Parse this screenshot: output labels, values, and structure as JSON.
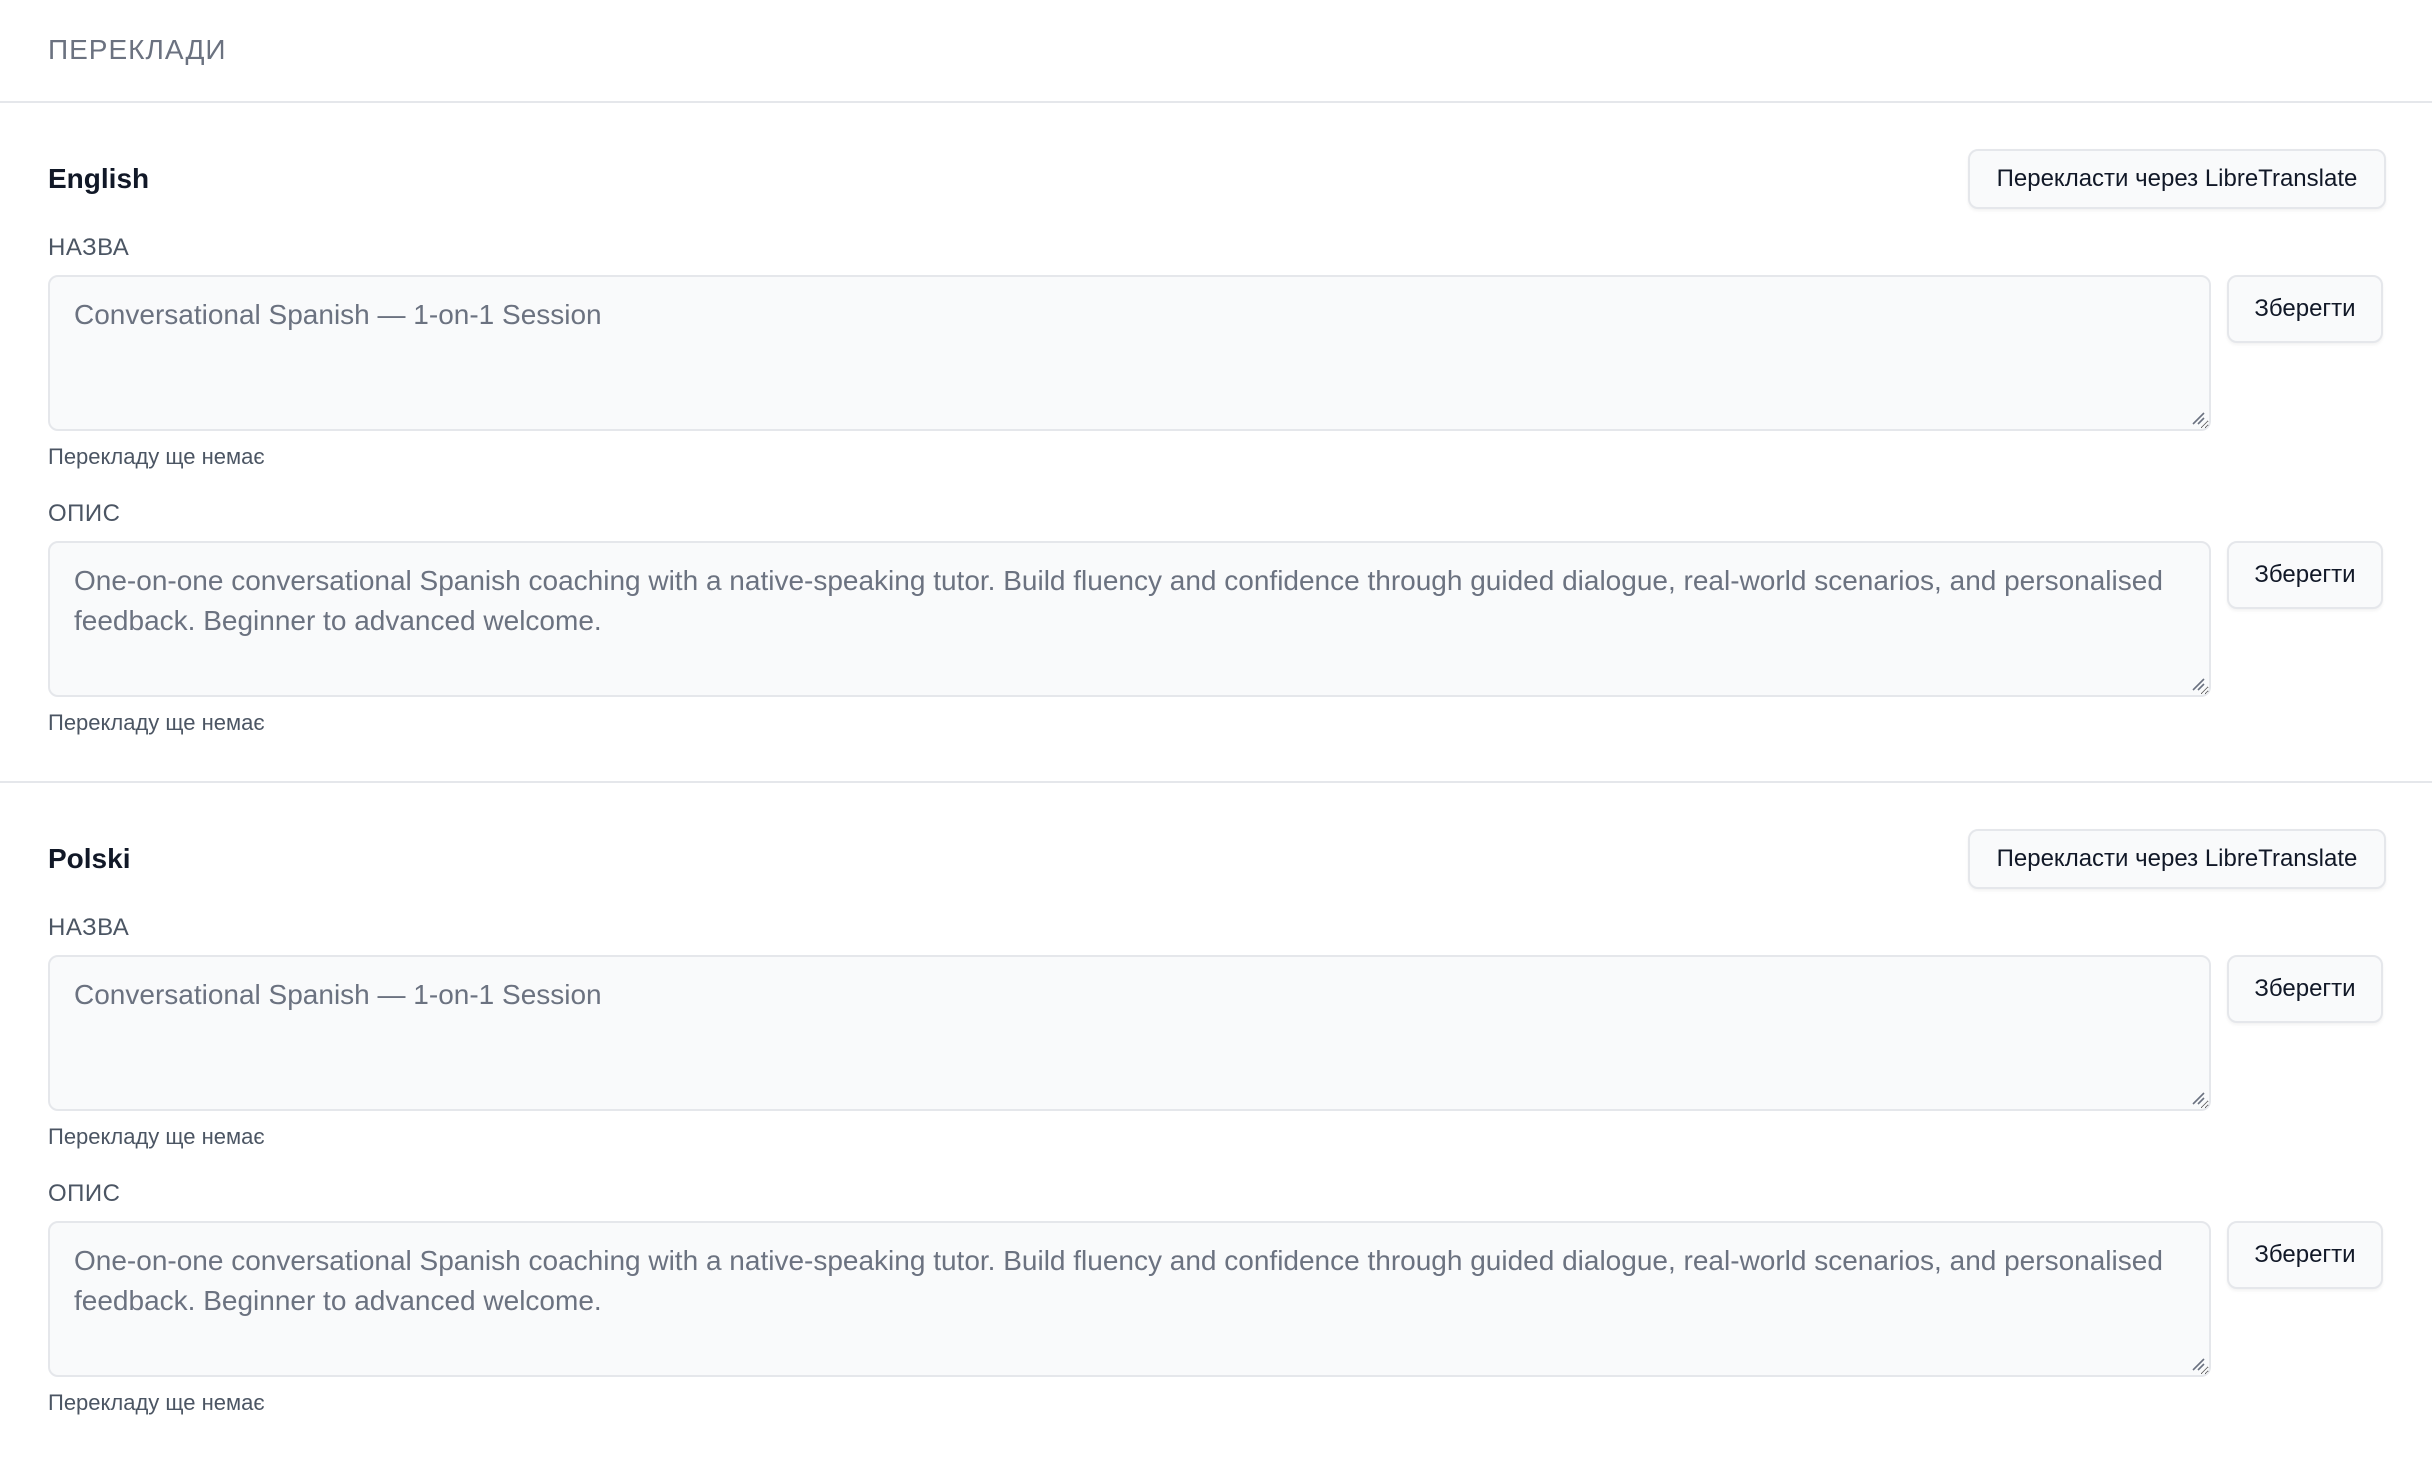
{
  "header": {
    "title": "ПЕРЕКЛАДИ"
  },
  "languages": [
    {
      "name": "English",
      "translate_label": "Перекласти через LibreTranslate",
      "fields": [
        {
          "label": "НАЗВА",
          "value": "Conversational Spanish — 1-on-1 Session",
          "save_label": "Зберегти",
          "note": "Перекладу ще немає"
        },
        {
          "label": "ОПИС",
          "value": "One-on-one conversational Spanish coaching with a native-speaking tutor. Build fluency and confidence through guided dialogue, real-world scenarios, and personalised feedback. Beginner to advanced welcome.",
          "save_label": "Зберегти",
          "note": "Перекладу ще немає"
        }
      ]
    },
    {
      "name": "Polski",
      "translate_label": "Перекласти через LibreTranslate",
      "fields": [
        {
          "label": "НАЗВА",
          "value": "Conversational Spanish — 1-on-1 Session",
          "save_label": "Зберегти",
          "note": "Перекладу ще немає"
        },
        {
          "label": "ОПИС",
          "value": "One-on-one conversational Spanish coaching with a native-speaking tutor. Build fluency and confidence through guided dialogue, real-world scenarios, and personalised feedback. Beginner to advanced welcome.",
          "save_label": "Зберегти",
          "note": "Перекладу ще немає"
        }
      ]
    }
  ],
  "colors": {
    "background": "#ffffff",
    "border": "#e5e7eb",
    "field_background": "#f9fafb",
    "muted_text": "#6b7280",
    "label_text": "#4b5563",
    "primary_text": "#111827"
  },
  "icons": {
    "resize_grip": "resize-grip-icon"
  }
}
